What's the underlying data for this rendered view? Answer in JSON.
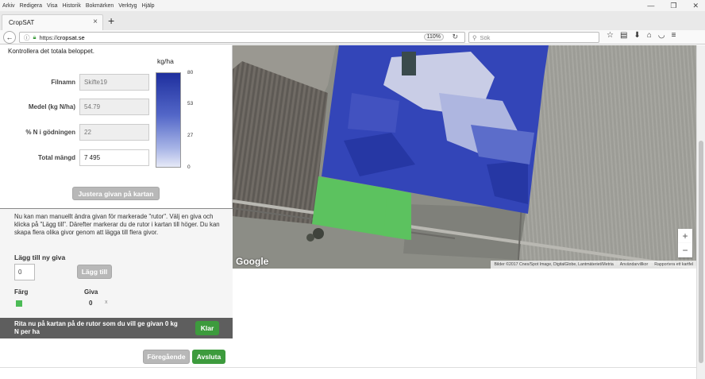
{
  "menubar": {
    "items": [
      "Arkiv",
      "Redigera",
      "Visa",
      "Historik",
      "Bokmärken",
      "Verktyg",
      "Hjälp"
    ]
  },
  "tab": {
    "title": "CropSAT",
    "close": "×",
    "new": "+"
  },
  "navbar": {
    "url_prefix": "https://",
    "url_host": "cropsat.se",
    "zoom": "110%",
    "search_placeholder": "Sök",
    "icons": [
      "star-icon",
      "clipboard-icon",
      "download-icon",
      "home-icon",
      "pocket-icon",
      "menu-icon"
    ]
  },
  "form": {
    "intro": "Kontrollera det totala beloppet.",
    "filename_label": "Filnamn",
    "filename_value": "Skifte19",
    "mean_label": "Medel (kg N/ha)",
    "mean_value": "54.79",
    "n_label": "% N i gödningen",
    "n_value": "22",
    "total_label": "Total mängd",
    "total_value": "7 495",
    "adjust_button": "Justera givan på kartan"
  },
  "legend": {
    "title": "kg/ha",
    "ticks": [
      "80",
      "53",
      "27",
      "0"
    ]
  },
  "manual": {
    "help": "Nu kan man manuellt ändra givan för markerade \"rutor\". Välj en giva och klicka på \"Lägg till\". Därefter markerar du de rutor i kartan till höger. Du kan skapa flera olika givor genom att lägga till flera givor.",
    "add_title": "Lägg till ny giva",
    "input_value": "0",
    "add_button": "Lägg till",
    "col_color": "Färg",
    "col_giva": "Giva",
    "rows": [
      {
        "value": "0",
        "delete": "x",
        "color": "#4cbb56"
      }
    ]
  },
  "instruction": {
    "text": "Rita nu på kartan på de rutor som du vill ge givan 0 kg N per ha",
    "done_button": "Klar"
  },
  "footer": {
    "prev_button": "Föregående",
    "finish_button": "Avsluta"
  },
  "map": {
    "zoom_in": "+",
    "zoom_out": "−",
    "logo": "Google",
    "attribution": "Bilder ©2017 Cnes/Spot Image, DigitalGlobe, Lantmäteriet/Metria",
    "terms": "Användarvillkor",
    "report": "Rapportera ett kartfel"
  },
  "colors": {
    "accent_green": "#3d9b3d",
    "button_gray": "#b8b8b8",
    "heat_blue": "#1e2f9e"
  }
}
